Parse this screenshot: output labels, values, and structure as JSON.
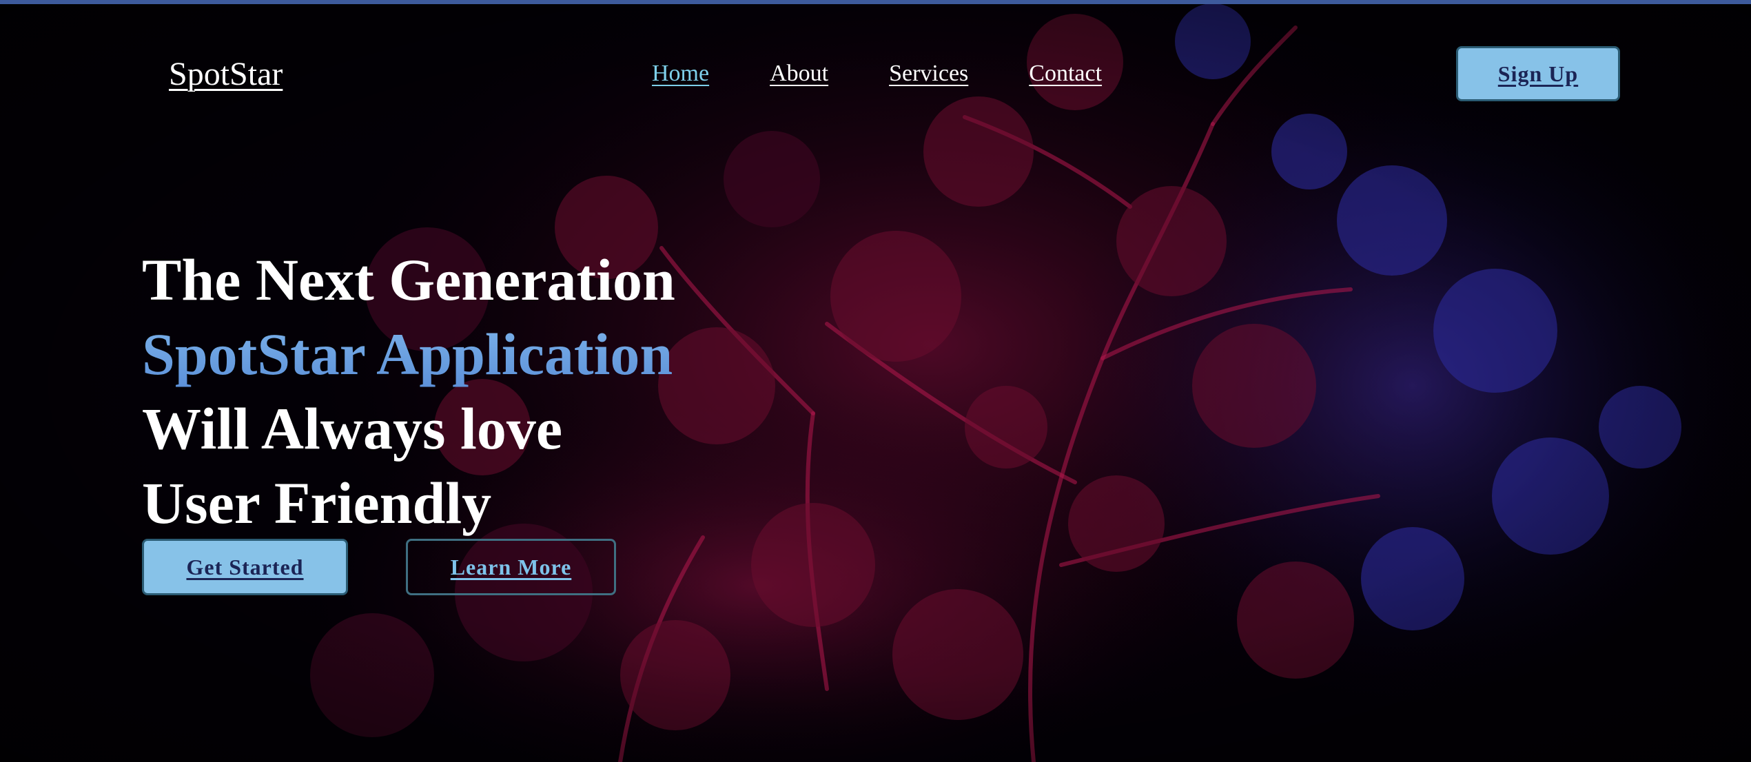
{
  "brand": {
    "logo_text": "SpotStar"
  },
  "nav": {
    "items": [
      {
        "label": "Home",
        "active": true
      },
      {
        "label": "About",
        "active": false
      },
      {
        "label": "Services",
        "active": false
      },
      {
        "label": "Contact",
        "active": false
      }
    ],
    "signup_label": "Sign Up"
  },
  "hero": {
    "lines": [
      "The Next Generation",
      "SpotStar Application",
      "Will Always love",
      "User Friendly"
    ],
    "primary_cta": "Get Started",
    "secondary_cta": "Learn More",
    "background": "dark foliage photo lit in red and blue"
  },
  "colors": {
    "background": "#020004",
    "accent": "#6aa1dd",
    "nav_active": "#7ed0ea",
    "button_fill": "#87c2e8",
    "button_text": "#1b2455",
    "top_border": "#3d5a9c"
  }
}
